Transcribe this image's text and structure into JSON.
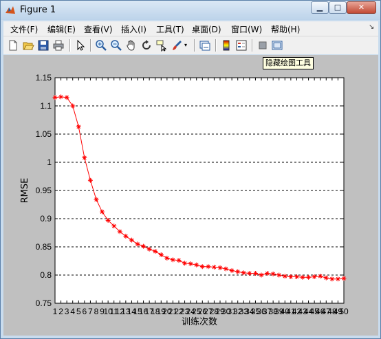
{
  "window": {
    "title": "Figure 1"
  },
  "menus": [
    "文件(F)",
    "编辑(E)",
    "查看(V)",
    "插入(I)",
    "工具(T)",
    "桌面(D)",
    "窗口(W)",
    "帮助(H)"
  ],
  "toolbar": {
    "icons": [
      "new-figure-icon",
      "open-file-icon",
      "save-icon",
      "print-icon",
      "pointer-icon",
      "zoom-in-icon",
      "zoom-out-icon",
      "pan-icon",
      "rotate-3d-icon",
      "data-cursor-icon",
      "brush-icon",
      "brush-dropdown-icon",
      "link-plot-icon",
      "insert-colorbar-icon",
      "insert-legend-icon",
      "hide-plot-tools-icon",
      "show-plot-tools-icon"
    ],
    "tooltip": "隐藏绘图工具"
  },
  "chart_data": {
    "type": "line",
    "title": "",
    "xlabel": "训练次数",
    "ylabel": "RMSE",
    "xlim": [
      1,
      50
    ],
    "ylim": [
      0.75,
      1.15
    ],
    "yticks": [
      0.75,
      0.8,
      0.85,
      0.9,
      0.95,
      1,
      1.05,
      1.1,
      1.15
    ],
    "xticks": [
      1,
      2,
      3,
      4,
      5,
      6,
      7,
      8,
      9,
      10,
      11,
      12,
      13,
      14,
      15,
      16,
      17,
      18,
      19,
      20,
      21,
      22,
      23,
      24,
      25,
      26,
      27,
      28,
      29,
      30,
      31,
      32,
      33,
      34,
      35,
      36,
      37,
      38,
      39,
      40,
      41,
      42,
      43,
      44,
      45,
      46,
      47,
      48,
      49,
      50
    ],
    "grid": "horizontal dashed",
    "series": [
      {
        "color": "#ff0000",
        "marker": "*",
        "x": [
          1,
          2,
          3,
          4,
          5,
          6,
          7,
          8,
          9,
          10,
          11,
          12,
          13,
          14,
          15,
          16,
          17,
          18,
          19,
          20,
          21,
          22,
          23,
          24,
          25,
          26,
          27,
          28,
          29,
          30,
          31,
          32,
          33,
          34,
          35,
          36,
          37,
          38,
          39,
          40,
          41,
          42,
          43,
          44,
          45,
          46,
          47,
          48,
          49,
          50
        ],
        "values": [
          1.115,
          1.116,
          1.115,
          1.1,
          1.063,
          1.008,
          0.968,
          0.934,
          0.912,
          0.897,
          0.887,
          0.877,
          0.869,
          0.862,
          0.855,
          0.851,
          0.846,
          0.842,
          0.836,
          0.83,
          0.827,
          0.826,
          0.821,
          0.82,
          0.818,
          0.815,
          0.815,
          0.814,
          0.813,
          0.811,
          0.808,
          0.806,
          0.804,
          0.803,
          0.803,
          0.8,
          0.803,
          0.802,
          0.8,
          0.798,
          0.797,
          0.797,
          0.796,
          0.796,
          0.797,
          0.798,
          0.795,
          0.793,
          0.793,
          0.794
        ]
      }
    ]
  }
}
